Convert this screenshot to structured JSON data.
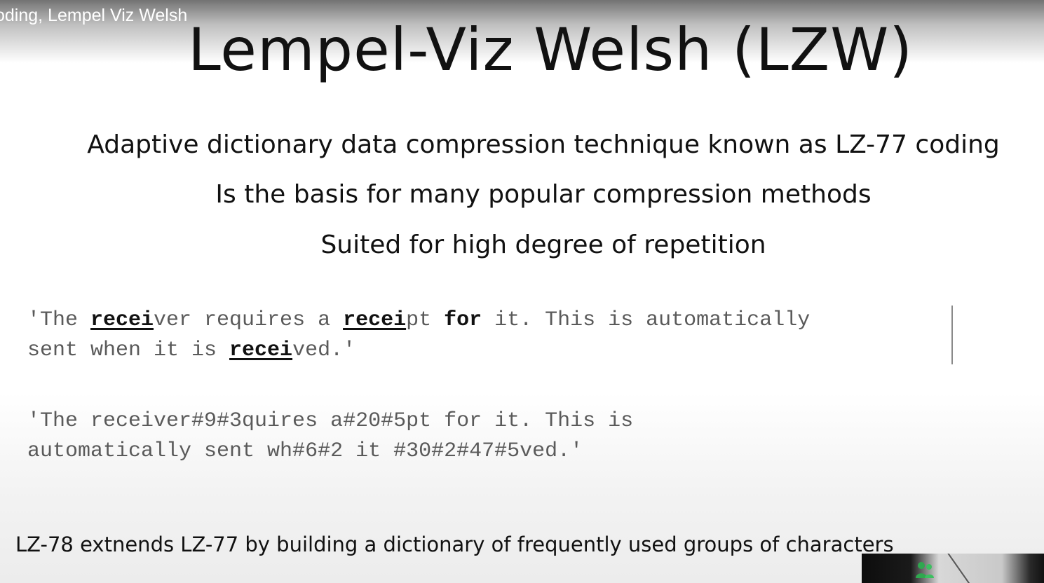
{
  "video": {
    "title": "oding, Lempel Viz Welsh"
  },
  "slide": {
    "title": "Lempel-Viz Welsh (LZW)",
    "bullets": [
      "Adaptive dictionary data compression technique known as LZ-77 coding",
      "Is the basis for many popular compression methods",
      "Suited for high degree of repetition"
    ],
    "example_original": {
      "line1": {
        "p1": "'The ",
        "h1": "recei",
        "p2": "ver requires a ",
        "h2": "recei",
        "p3": "pt ",
        "k1": "for",
        "p4": " it. This is automatically"
      },
      "line2": {
        "p1": "sent when it is ",
        "h1": "recei",
        "p2": "ved.'"
      }
    },
    "example_encoded": {
      "line1": "'The receiver#9#3quires a#20#5pt for it. This is",
      "line2": "automatically sent wh#6#2 it #30#2#47#5ved.'"
    },
    "footnote": "LZ-78 extnends LZ-77 by building a dictionary of frequently used groups of characters"
  },
  "overlay": {
    "webcam_icon": "user-group-icon",
    "icon_color": "#2fa84f"
  }
}
